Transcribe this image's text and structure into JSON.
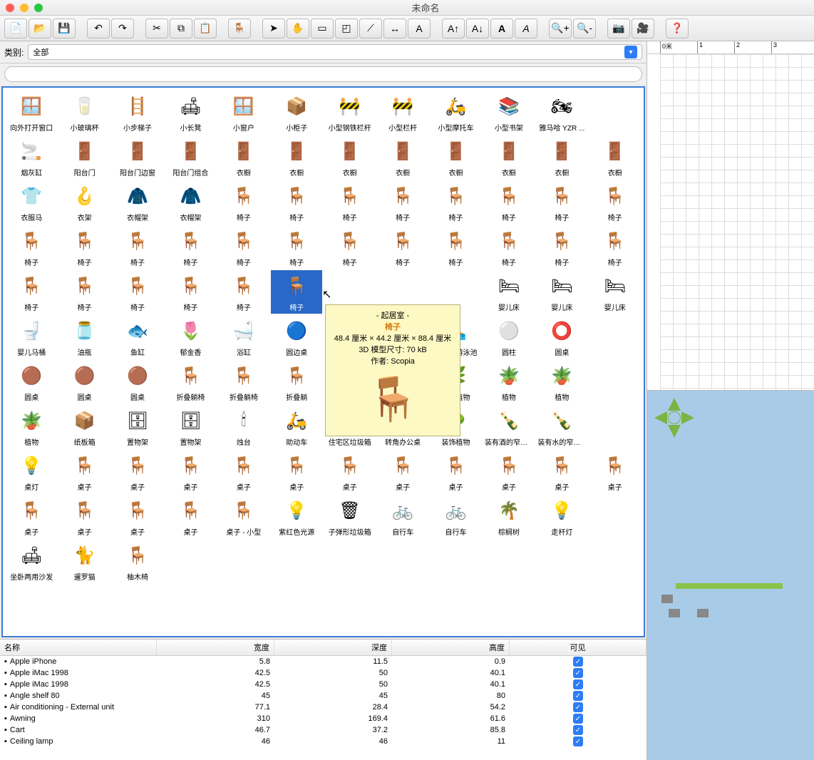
{
  "window": {
    "title": "未命名"
  },
  "category": {
    "label": "类别:",
    "value": "全部"
  },
  "tooltip": {
    "room": "- 起居室 -",
    "name": "椅子",
    "dims": "48.4 厘米 × 44.2 厘米 × 88.4 厘米",
    "size": "3D 模型尺寸: 70 kB",
    "author": "作者: Scopia"
  },
  "ruler": [
    "0米",
    "1",
    "2",
    "3"
  ],
  "items": [
    {
      "l": "向外打开窗口",
      "i": "🪟"
    },
    {
      "l": "小玻璃杯",
      "i": "🥛"
    },
    {
      "l": "小步梯子",
      "i": "🪜"
    },
    {
      "l": "小长凳",
      "i": "🛋"
    },
    {
      "l": "小窗户",
      "i": "🪟"
    },
    {
      "l": "小柜子",
      "i": "📦"
    },
    {
      "l": "小型钢铁栏杆",
      "i": "🚧"
    },
    {
      "l": "小型栏杆",
      "i": "🚧"
    },
    {
      "l": "小型摩托车",
      "i": "🛵"
    },
    {
      "l": "小型书架",
      "i": "📚"
    },
    {
      "l": "雅马哈 YZR ...",
      "i": "🏍"
    },
    {
      "l": "",
      "i": ""
    },
    {
      "l": "烟灰缸",
      "i": "🚬"
    },
    {
      "l": "阳台门",
      "i": "🚪"
    },
    {
      "l": "阳台门边窗",
      "i": "🚪"
    },
    {
      "l": "阳台门组合",
      "i": "🚪"
    },
    {
      "l": "衣橱",
      "i": "🚪"
    },
    {
      "l": "衣橱",
      "i": "🚪"
    },
    {
      "l": "衣橱",
      "i": "🚪"
    },
    {
      "l": "衣橱",
      "i": "🚪"
    },
    {
      "l": "衣橱",
      "i": "🚪"
    },
    {
      "l": "衣橱",
      "i": "🚪"
    },
    {
      "l": "衣橱",
      "i": "🚪"
    },
    {
      "l": "衣橱",
      "i": "🚪"
    },
    {
      "l": "衣服马",
      "i": "👕"
    },
    {
      "l": "衣架",
      "i": "🪝"
    },
    {
      "l": "衣帽架",
      "i": "🧥"
    },
    {
      "l": "衣帽架",
      "i": "🧥"
    },
    {
      "l": "椅子",
      "i": "🪑"
    },
    {
      "l": "椅子",
      "i": "🪑"
    },
    {
      "l": "椅子",
      "i": "🪑"
    },
    {
      "l": "椅子",
      "i": "🪑"
    },
    {
      "l": "椅子",
      "i": "🪑"
    },
    {
      "l": "椅子",
      "i": "🪑"
    },
    {
      "l": "椅子",
      "i": "🪑"
    },
    {
      "l": "椅子",
      "i": "🪑"
    },
    {
      "l": "椅子",
      "i": "🪑"
    },
    {
      "l": "椅子",
      "i": "🪑"
    },
    {
      "l": "椅子",
      "i": "🪑"
    },
    {
      "l": "椅子",
      "i": "🪑"
    },
    {
      "l": "椅子",
      "i": "🪑"
    },
    {
      "l": "椅子",
      "i": "🪑"
    },
    {
      "l": "椅子",
      "i": "🪑"
    },
    {
      "l": "椅子",
      "i": "🪑"
    },
    {
      "l": "椅子",
      "i": "🪑"
    },
    {
      "l": "椅子",
      "i": "🪑"
    },
    {
      "l": "椅子",
      "i": "🪑"
    },
    {
      "l": "椅子",
      "i": "🪑"
    },
    {
      "l": "椅子",
      "i": "🪑"
    },
    {
      "l": "椅子",
      "i": "🪑"
    },
    {
      "l": "椅子",
      "i": "🪑"
    },
    {
      "l": "椅子",
      "i": "🪑"
    },
    {
      "l": "椅子",
      "i": "🪑"
    },
    {
      "l": "椅子",
      "i": "🪑",
      "sel": true
    },
    {
      "l": "",
      "i": ""
    },
    {
      "l": "",
      "i": ""
    },
    {
      "l": "",
      "i": ""
    },
    {
      "l": "婴儿床",
      "i": "🛏"
    },
    {
      "l": "婴儿床",
      "i": "🛏"
    },
    {
      "l": "婴儿床",
      "i": "🛏"
    },
    {
      "l": "婴儿马桶",
      "i": "🚽"
    },
    {
      "l": "油瓶",
      "i": "🫙"
    },
    {
      "l": "鱼缸",
      "i": "🐟"
    },
    {
      "l": "郁金香",
      "i": "🌷"
    },
    {
      "l": "浴缸",
      "i": "🛁"
    },
    {
      "l": "圆边桌",
      "i": "🔵"
    },
    {
      "l": "",
      "i": ""
    },
    {
      "l": "",
      "i": ""
    },
    {
      "l": "圆形的游泳池",
      "i": "🏊"
    },
    {
      "l": "圆柱",
      "i": "⚪"
    },
    {
      "l": "圆桌",
      "i": "⭕"
    },
    {
      "l": "",
      "i": ""
    },
    {
      "l": "圆桌",
      "i": "🟤"
    },
    {
      "l": "圆桌",
      "i": "🟤"
    },
    {
      "l": "圆桌",
      "i": "🟤"
    },
    {
      "l": "折叠躺椅",
      "i": "🪑"
    },
    {
      "l": "折叠躺椅",
      "i": "🪑"
    },
    {
      "l": "折叠躺",
      "i": "🪑"
    },
    {
      "l": "",
      "i": ""
    },
    {
      "l": "",
      "i": ""
    },
    {
      "l": "蜘蛛植物",
      "i": "🌿"
    },
    {
      "l": "植物",
      "i": "🪴"
    },
    {
      "l": "植物",
      "i": "🪴"
    },
    {
      "l": "",
      "i": ""
    },
    {
      "l": "植物",
      "i": "🪴"
    },
    {
      "l": "纸板箱",
      "i": "📦"
    },
    {
      "l": "置物架",
      "i": "🗄"
    },
    {
      "l": "置物架",
      "i": "🗄"
    },
    {
      "l": "烛台",
      "i": "🕯"
    },
    {
      "l": "助动车",
      "i": "🛵"
    },
    {
      "l": "住宅区垃圾箱",
      "i": "🗑"
    },
    {
      "l": "转角办公桌",
      "i": "🪑"
    },
    {
      "l": "装饰植物",
      "i": "🌳"
    },
    {
      "l": "装有酒的窄颈...",
      "i": "🍾"
    },
    {
      "l": "装有水的窄颈...",
      "i": "🍾"
    },
    {
      "l": "",
      "i": ""
    },
    {
      "l": "桌灯",
      "i": "💡"
    },
    {
      "l": "桌子",
      "i": "🪑"
    },
    {
      "l": "桌子",
      "i": "🪑"
    },
    {
      "l": "桌子",
      "i": "🪑"
    },
    {
      "l": "桌子",
      "i": "🪑"
    },
    {
      "l": "桌子",
      "i": "🪑"
    },
    {
      "l": "桌子",
      "i": "🪑"
    },
    {
      "l": "桌子",
      "i": "🪑"
    },
    {
      "l": "桌子",
      "i": "🪑"
    },
    {
      "l": "桌子",
      "i": "🪑"
    },
    {
      "l": "桌子",
      "i": "🪑"
    },
    {
      "l": "桌子",
      "i": "🪑"
    },
    {
      "l": "桌子",
      "i": "🪑"
    },
    {
      "l": "桌子",
      "i": "🪑"
    },
    {
      "l": "桌子",
      "i": "🪑"
    },
    {
      "l": "桌子",
      "i": "🪑"
    },
    {
      "l": "桌子 - 小型",
      "i": "🪑"
    },
    {
      "l": "紫红色光源",
      "i": "💡"
    },
    {
      "l": "子弹形垃圾箱",
      "i": "🗑"
    },
    {
      "l": "自行车",
      "i": "🚲"
    },
    {
      "l": "自行车",
      "i": "🚲"
    },
    {
      "l": "棕榈树",
      "i": "🌴"
    },
    {
      "l": "走杆灯",
      "i": "💡"
    },
    {
      "l": "",
      "i": ""
    },
    {
      "l": "坐卧两用沙发",
      "i": "🛋"
    },
    {
      "l": "暹罗猫",
      "i": "🐈"
    },
    {
      "l": "柚木椅",
      "i": "🪑"
    }
  ],
  "table": {
    "headers": {
      "name": "名称",
      "width": "宽度",
      "depth": "深度",
      "height": "高度",
      "visible": "可见"
    },
    "rows": [
      {
        "name": "Apple iPhone",
        "w": "5.8",
        "d": "11.5",
        "h": "0.9",
        "v": true
      },
      {
        "name": "Apple iMac 1998",
        "w": "42.5",
        "d": "50",
        "h": "40.1",
        "v": true
      },
      {
        "name": "Apple iMac 1998",
        "w": "42.5",
        "d": "50",
        "h": "40.1",
        "v": true
      },
      {
        "name": "Angle shelf 80",
        "w": "45",
        "d": "45",
        "h": "80",
        "v": true
      },
      {
        "name": "Air conditioning - External unit",
        "w": "77.1",
        "d": "28.4",
        "h": "54.2",
        "v": true
      },
      {
        "name": "Awning",
        "w": "310",
        "d": "169.4",
        "h": "61.6",
        "v": true
      },
      {
        "name": "Cart",
        "w": "46.7",
        "d": "37.2",
        "h": "85.8",
        "v": true
      },
      {
        "name": "Ceiling lamp",
        "w": "46",
        "d": "46",
        "h": "11",
        "v": true
      }
    ]
  }
}
